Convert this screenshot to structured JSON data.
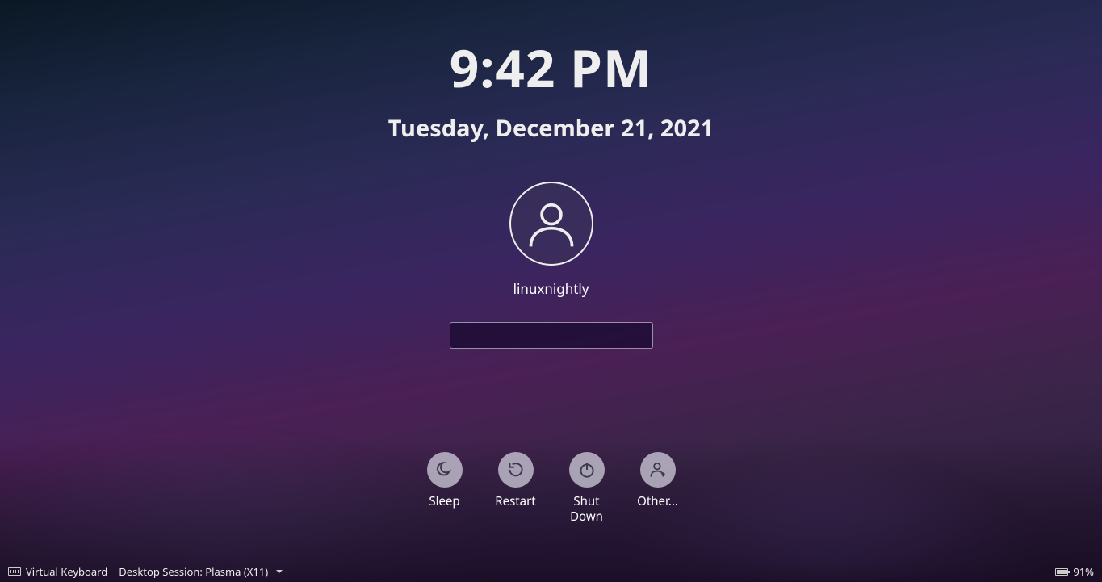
{
  "clock": {
    "time": "9:42 PM",
    "date": "Tuesday, December 21, 2021"
  },
  "user": {
    "name": "linuxnightly",
    "password_value": ""
  },
  "actions": {
    "sleep": "Sleep",
    "restart": "Restart",
    "shutdown": "Shut\nDown",
    "other": "Other..."
  },
  "footer": {
    "virtual_keyboard": "Virtual Keyboard",
    "session_label": "Desktop Session: Plasma (X11)",
    "battery": "91%"
  }
}
